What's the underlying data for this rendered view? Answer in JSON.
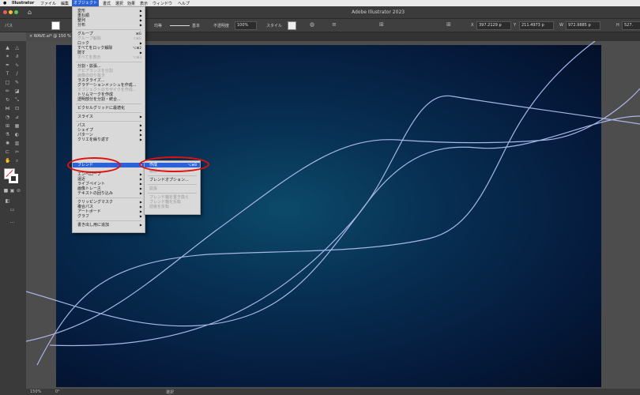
{
  "menubar": {
    "apple": "",
    "items": [
      "Illustrator",
      "ファイル",
      "編集",
      "オブジェクト",
      "書式",
      "選択",
      "効果",
      "表示",
      "ウィンドウ",
      "ヘルプ"
    ],
    "active_index": 3
  },
  "titlebar": {
    "title": "Adobe Illustrator 2023"
  },
  "controlbar": {
    "path_label": "パス",
    "stroke_profile": "均等",
    "brush": "基本",
    "opacity_label": "不透明度",
    "opacity_value": "100%",
    "style_label": "スタイル",
    "x_label": "X",
    "x_value": "397.2129 p",
    "y_label": "Y",
    "y_value": "211.4973 p",
    "w_label": "W",
    "w_value": "972.9885 p",
    "h_label": "H",
    "h_value": "527."
  },
  "tab": {
    "label": "WAVE.ai* @ 150 %"
  },
  "statusbar": {
    "zoom": "150%",
    "angle": "0°",
    "tool": "選択"
  },
  "object_menu": {
    "items": [
      {
        "label": "変形",
        "shortcut": "",
        "disabled": false,
        "arrow": true
      },
      {
        "label": "重ね順",
        "shortcut": "",
        "disabled": false,
        "arrow": true
      },
      {
        "label": "整列",
        "shortcut": "",
        "disabled": false,
        "arrow": true
      },
      {
        "label": "分布",
        "shortcut": "",
        "disabled": false,
        "arrow": true
      },
      {
        "label": "グループ",
        "shortcut": "⌘G",
        "disabled": false,
        "arrow": false
      },
      {
        "label": "グループ解除",
        "shortcut": "⇧⌘G",
        "disabled": true,
        "arrow": false
      },
      {
        "label": "ロック",
        "shortcut": "",
        "disabled": false,
        "arrow": true
      },
      {
        "label": "すべてをロック解除",
        "shortcut": "⌥⌘2",
        "disabled": false,
        "arrow": false
      },
      {
        "label": "隠す",
        "shortcut": "",
        "disabled": false,
        "arrow": true
      },
      {
        "label": "すべてを表示",
        "shortcut": "⌥⌘3",
        "disabled": true,
        "arrow": false
      },
      {
        "label": "分割・拡張...",
        "shortcut": "",
        "disabled": false,
        "arrow": false
      },
      {
        "label": "アピアランスを分割",
        "shortcut": "",
        "disabled": true,
        "arrow": false
      },
      {
        "label": "画像の切り抜き",
        "shortcut": "",
        "disabled": true,
        "arrow": false
      },
      {
        "label": "ラスタライズ...",
        "shortcut": "",
        "disabled": false,
        "arrow": false
      },
      {
        "label": "グラデーションメッシュを作成...",
        "shortcut": "",
        "disabled": false,
        "arrow": false
      },
      {
        "label": "オブジェクトのモザイクを作成...",
        "shortcut": "",
        "disabled": true,
        "arrow": false
      },
      {
        "label": "トリムマークを作成",
        "shortcut": "",
        "disabled": false,
        "arrow": false
      },
      {
        "label": "透明部分を分割・統合...",
        "shortcut": "",
        "disabled": false,
        "arrow": false
      },
      {
        "label": "ピクセルグリッドに最適化",
        "shortcut": "",
        "disabled": false,
        "arrow": false
      },
      {
        "label": "スライス",
        "shortcut": "",
        "disabled": false,
        "arrow": true
      },
      {
        "label": "パス",
        "shortcut": "",
        "disabled": false,
        "arrow": true
      },
      {
        "label": "シェイプ",
        "shortcut": "",
        "disabled": false,
        "arrow": true
      },
      {
        "label": "パターン",
        "shortcut": "",
        "disabled": false,
        "arrow": true
      },
      {
        "label": "クリエを繰り返す",
        "shortcut": "",
        "disabled": false,
        "arrow": true
      },
      {
        "label": "ブレンド",
        "shortcut": "",
        "disabled": false,
        "arrow": true
      },
      {
        "label": "エンベロープ",
        "shortcut": "",
        "disabled": false,
        "arrow": true
      },
      {
        "label": "遠近",
        "shortcut": "",
        "disabled": false,
        "arrow": true
      },
      {
        "label": "ライブペイント",
        "shortcut": "",
        "disabled": false,
        "arrow": true
      },
      {
        "label": "画像トレース",
        "shortcut": "",
        "disabled": false,
        "arrow": true
      },
      {
        "label": "テキストの回り込み",
        "shortcut": "",
        "disabled": false,
        "arrow": true
      },
      {
        "label": "クリッピングマスク",
        "shortcut": "",
        "disabled": false,
        "arrow": true
      },
      {
        "label": "複合パス",
        "shortcut": "",
        "disabled": false,
        "arrow": true
      },
      {
        "label": "アートボード",
        "shortcut": "",
        "disabled": false,
        "arrow": true
      },
      {
        "label": "グラフ",
        "shortcut": "",
        "disabled": false,
        "arrow": true
      },
      {
        "label": "書き出し用に追加",
        "shortcut": "",
        "disabled": false,
        "arrow": true
      }
    ]
  },
  "blend_submenu": {
    "items": [
      {
        "label": "作成",
        "shortcut": "⌥⌘B",
        "disabled": false
      },
      {
        "label": "解除",
        "shortcut": "",
        "disabled": true
      },
      {
        "label": "ブレンドオプション...",
        "shortcut": "",
        "disabled": false
      },
      {
        "label": "拡張",
        "shortcut": "",
        "disabled": true
      },
      {
        "label": "ブレンド軸を置き換え",
        "shortcut": "",
        "disabled": true
      },
      {
        "label": "ブレンド軸を反転",
        "shortcut": "",
        "disabled": true
      },
      {
        "label": "前後を反転",
        "shortcut": "",
        "disabled": true
      }
    ]
  },
  "colors": {
    "highlight": "#2b62d8",
    "annotation": "#e01010",
    "curve": "#a9b6e8"
  }
}
